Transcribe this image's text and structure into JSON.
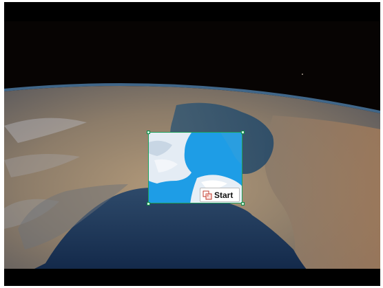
{
  "capture_overlay": {
    "start_button_label": "Start",
    "start_icon": "region-capture-icon",
    "selection_border_color": "#1ea05a"
  },
  "background": {
    "type": "earth-from-orbit-photo"
  }
}
